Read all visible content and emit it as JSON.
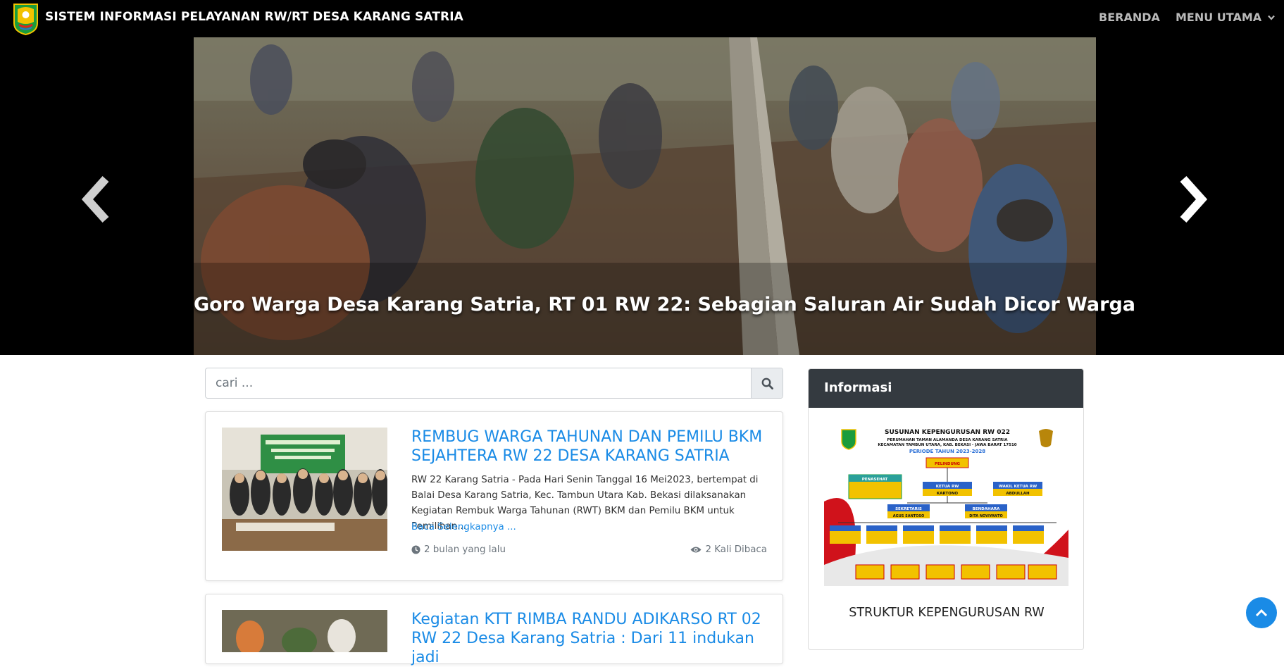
{
  "navbar": {
    "title": "SISTEM INFORMASI PELAYANAN RW/RT DESA KARANG SATRIA",
    "links": [
      {
        "label": "BERANDA"
      },
      {
        "label": "MENU UTAMA",
        "icon": "chevron-down-icon"
      }
    ],
    "logo": "village-emblem-logo"
  },
  "hero": {
    "caption": "Goro Warga Desa Karang Satria, RT 01 RW 22: Sebagian Saluran Air Sudah Dicor Warga",
    "prev_icon": "chevron-left-icon",
    "next_icon": "chevron-right-icon"
  },
  "search": {
    "placeholder": "cari ...",
    "icon": "search-icon"
  },
  "articles": [
    {
      "title": "REMBUG WARGA TAHUNAN DAN PEMILU BKM SEJAHTERA RW 22 DESA KARANG SATRIA",
      "excerpt": "RW 22 Karang Satria - Pada Hari Senin Tanggal 16 Mei2023, bertempat di Balai Desa Karang Satria, Kec. Tambun Utara Kab. Bekasi dilaksanakan Kegiatan Rembuk Warga Tahunan (RWT) BKM dan Pemilu BKM untuk Pemilihan...",
      "read_more": "Baca Selengkapnya ...",
      "time": "2 bulan yang lalu",
      "views": "2 Kali Dibaca"
    },
    {
      "title": "Kegiatan KTT RIMBA RANDU ADIKARSO RT 02 RW 22 Desa Karang Satria : Dari 11 indukan jadi"
    }
  ],
  "sidebar": {
    "header": "Informasi",
    "caption": "STRUKTUR KEPENGURUSAN RW",
    "image_text": {
      "title": "SUSUNAN KEPENGURUSAN RW 022",
      "subtitle": "PERUMAHAN TAMAN ALAMANDA DESA KARANG SATRIA",
      "address": "KECAMATAN TAMBUN UTARA, KAB. BEKASI - JAWA BARAT 17510",
      "period": "PERIODE TAHUN 2023-2028",
      "pelindung": "PELINDUNG",
      "ketua": "KETUA RW",
      "ketua_name": "KARTONO",
      "wakil": "WAKIL KETUA RW",
      "wakil_name": "ABDULLAH",
      "sekretaris": "SEKRETARIS",
      "sekretaris_name": "AGUS SANTOSO",
      "bendahara": "BENDAHARA",
      "bendahara_name": "DITA NOVIYANTO",
      "penasehat": "PENASEHAT"
    }
  },
  "colors": {
    "accent": "#1a8be6",
    "navbar": "#000000",
    "sidebar_header": "#343a40"
  },
  "back_to_top_icon": "chevron-up-icon"
}
